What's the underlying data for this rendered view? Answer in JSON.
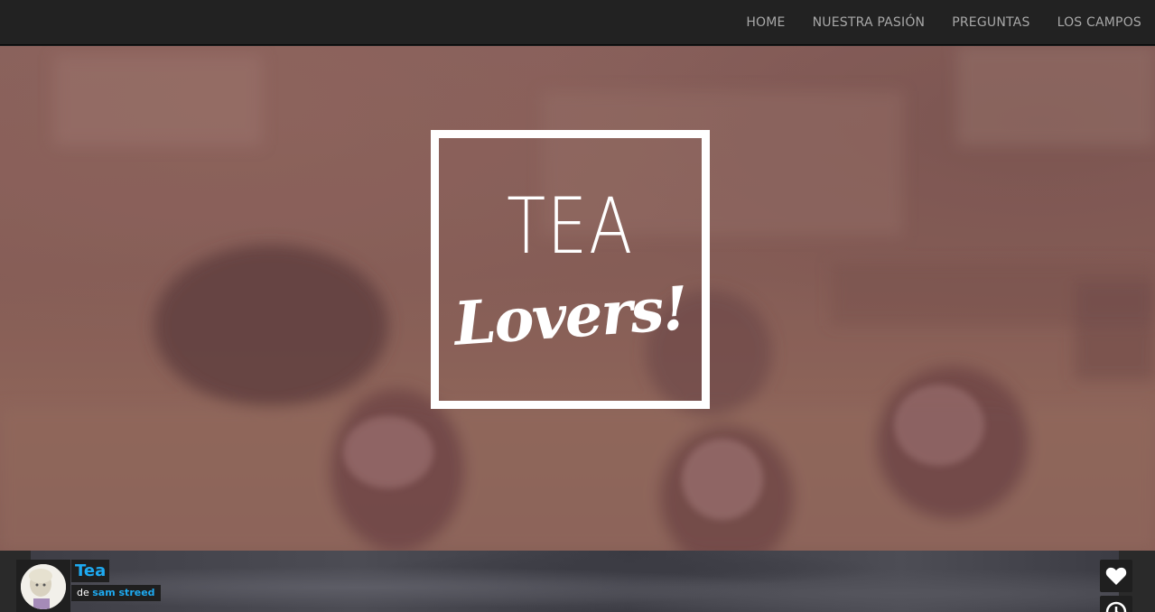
{
  "nav": {
    "items": [
      {
        "label": "HOME"
      },
      {
        "label": "NUESTRA PASIÓN"
      },
      {
        "label": "PREGUNTAS"
      },
      {
        "label": "LOS CAMPOS"
      }
    ]
  },
  "hero": {
    "logo_line1": "TEA",
    "logo_line2": "Lovers!"
  },
  "embed": {
    "title": "Tea",
    "byline_prefix": "de",
    "author": "sam streed"
  },
  "icons": {
    "like": "heart-icon",
    "watch_later": "clock-icon"
  },
  "colors": {
    "nav_bg": "#222222",
    "nav_text": "#a8a8a8",
    "accent_link": "#1eaaf1",
    "logo": "#ffffff"
  }
}
